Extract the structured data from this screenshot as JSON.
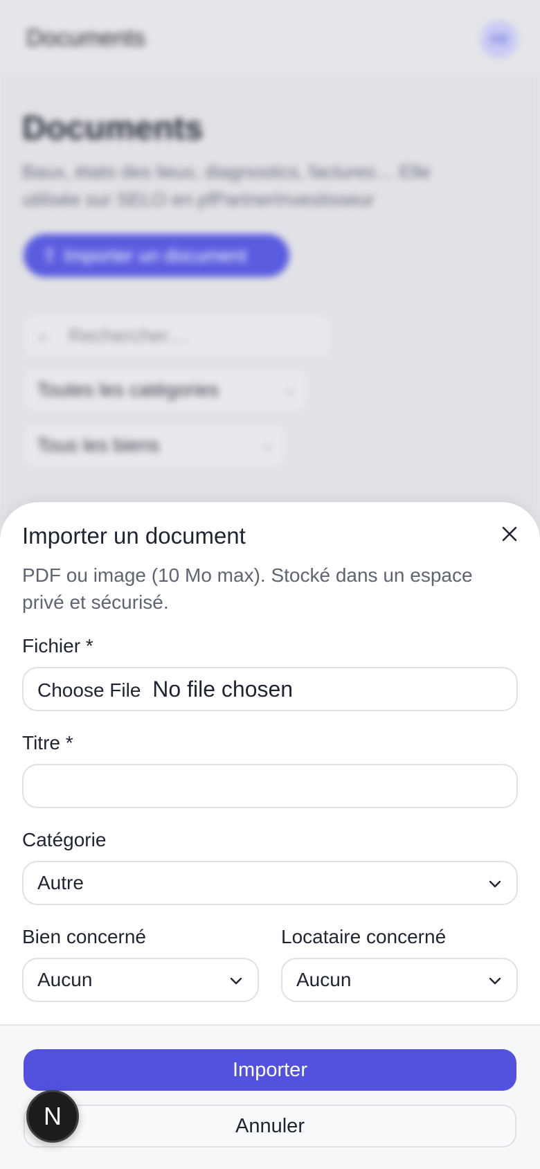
{
  "background": {
    "topbar_title": "Documents",
    "avatar_initials": "RB",
    "heading": "Documents",
    "subtitle": "Baux, états des lieux, diagnostics, factures… Elle utilisée sur SELO en pfPartnerInvestisseur",
    "import_button": "Importer un document",
    "search_placeholder": "Rechercher…",
    "category_filter": "Toutes les catégories",
    "property_filter": "Tous les biens"
  },
  "sheet": {
    "title": "Importer un document",
    "description": "PDF ou image (10 Mo max). Stocké dans un espace privé et sécurisé.",
    "file_label": "Fichier *",
    "file_button": "Choose File",
    "file_status": "No file chosen",
    "title_label": "Titre *",
    "title_value": "",
    "category_label": "Catégorie",
    "category_value": "Autre",
    "property_label": "Bien concerné",
    "property_value": "Aucun",
    "tenant_label": "Locataire concerné",
    "tenant_value": "Aucun",
    "submit_label": "Importer",
    "cancel_label": "Annuler"
  },
  "dev_badge": "N",
  "colors": {
    "primary": "#5252de",
    "sheet_bg": "#ffffff",
    "footer_bg": "#f6f7f9",
    "overlay_bg": "#e1e2e6"
  },
  "icons": {
    "close": "close-icon",
    "chevron": "chevron-down-icon",
    "search": "search-icon",
    "upload": "upload-icon"
  }
}
